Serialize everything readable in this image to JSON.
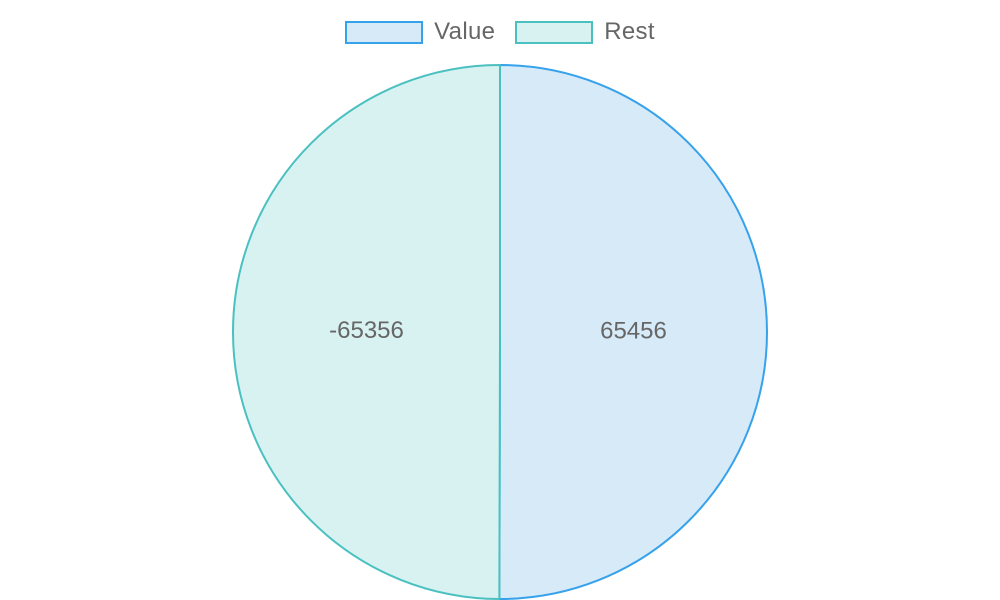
{
  "chart_data": {
    "type": "pie",
    "categories": [
      "Value",
      "Rest"
    ],
    "values": [
      65456,
      -65356
    ],
    "data_labels": [
      "65456",
      "-65356"
    ],
    "colors": {
      "Value": {
        "fill": "#d6eaf8",
        "stroke": "#36a2eb"
      },
      "Rest": {
        "fill": "#d8f2f2",
        "stroke": "#4bc0c0"
      }
    },
    "legend": "top"
  },
  "legend": {
    "items": [
      {
        "label": "Value"
      },
      {
        "label": "Rest"
      }
    ]
  }
}
